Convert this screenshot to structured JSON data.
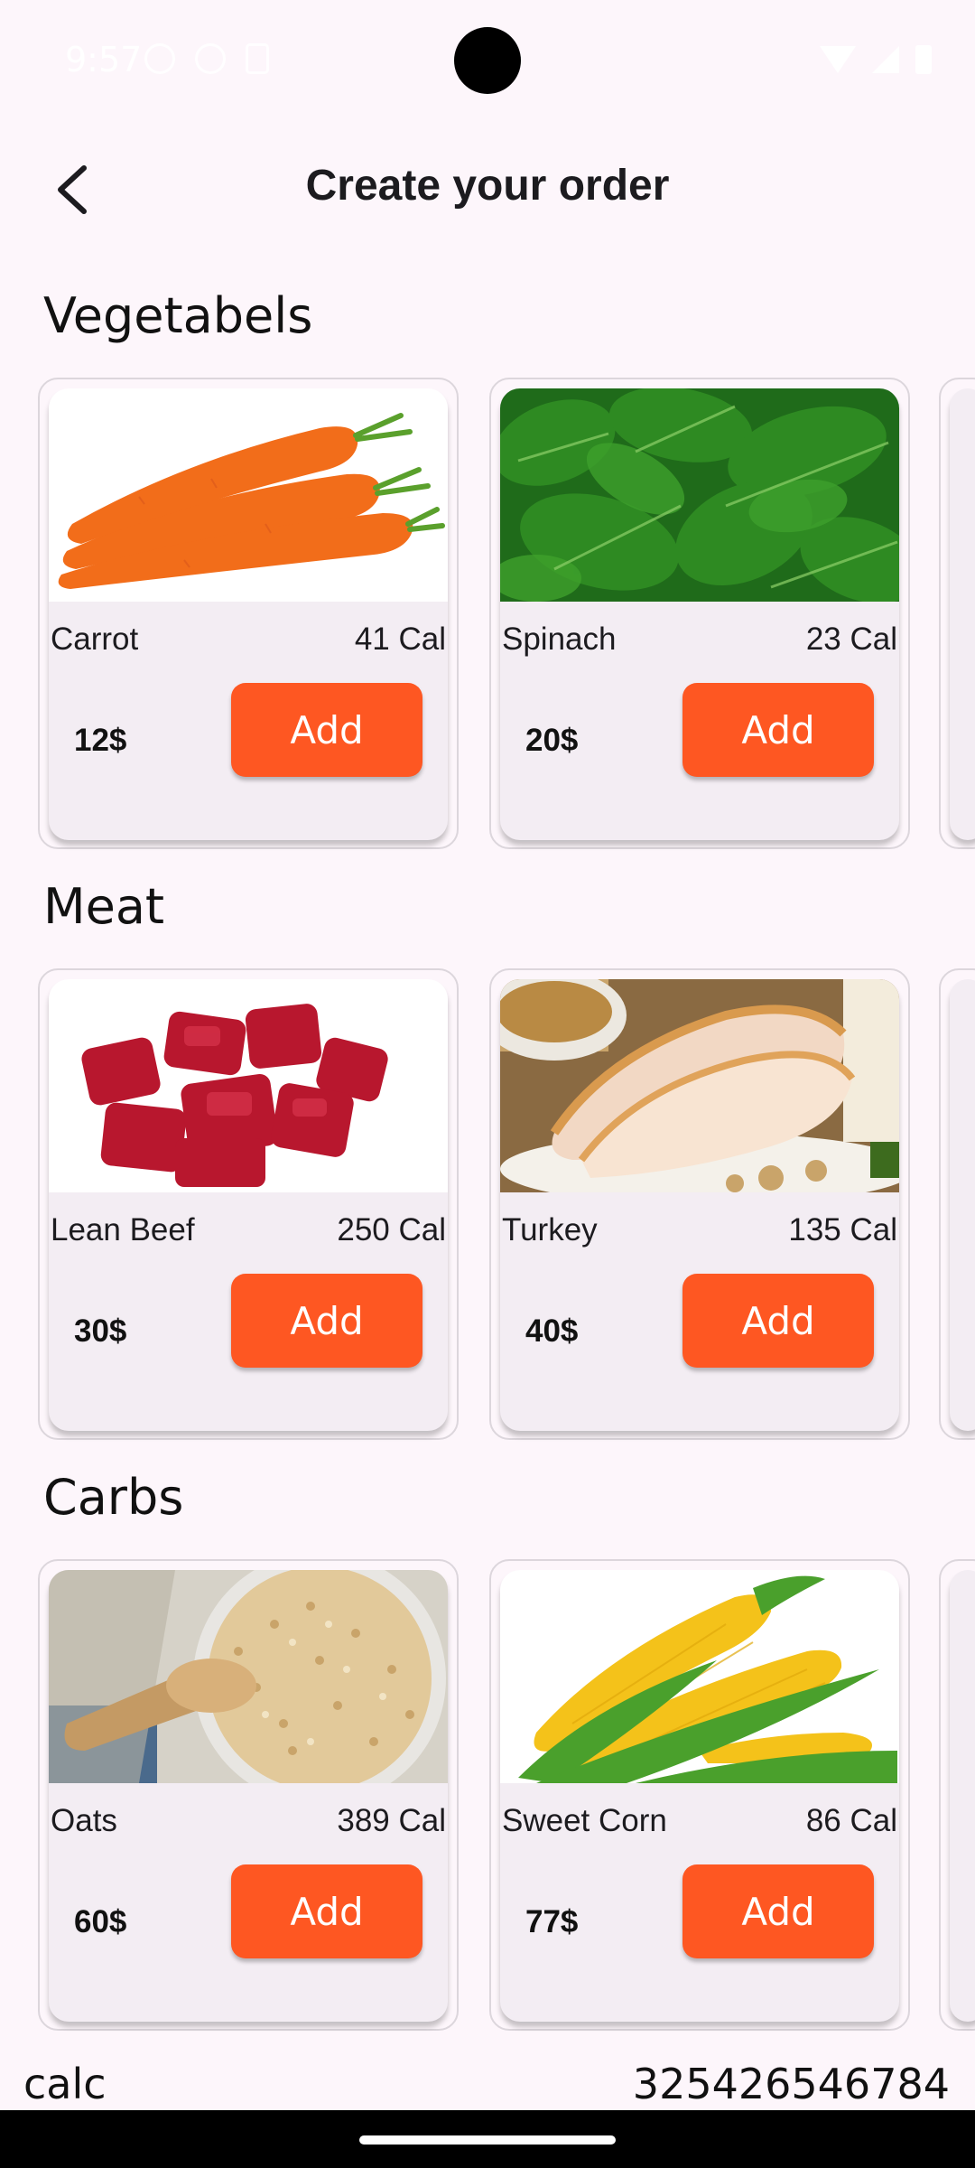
{
  "status_bar": {
    "time": "9:57"
  },
  "header": {
    "title": "Create your order",
    "back_icon": "chevron-left-icon"
  },
  "sections": [
    {
      "title": "Vegetabels",
      "items": [
        {
          "name": "Carrot",
          "calories": "41 Cal",
          "price": "12$",
          "button": "Add",
          "image": "carrot-image"
        },
        {
          "name": "Spinach",
          "calories": "23 Cal",
          "price": "20$",
          "button": "Add",
          "image": "spinach-image"
        }
      ]
    },
    {
      "title": "Meat",
      "items": [
        {
          "name": "Lean Beef",
          "calories": "250 Cal",
          "price": "30$",
          "button": "Add",
          "image": "beef-image"
        },
        {
          "name": "Turkey",
          "calories": "135 Cal",
          "price": "40$",
          "button": "Add",
          "image": "turkey-image"
        }
      ]
    },
    {
      "title": "Carbs",
      "items": [
        {
          "name": "Oats",
          "calories": "389 Cal",
          "price": "60$",
          "button": "Add",
          "image": "oats-image"
        },
        {
          "name": "Sweet Corn",
          "calories": "86 Cal",
          "price": "77$",
          "button": "Add",
          "image": "corn-image"
        }
      ]
    }
  ],
  "footer": {
    "label": "calc",
    "value": "325426546784"
  },
  "colors": {
    "accent": "#fe5722",
    "background": "#fdf6fb",
    "card": "#f3edf3"
  }
}
